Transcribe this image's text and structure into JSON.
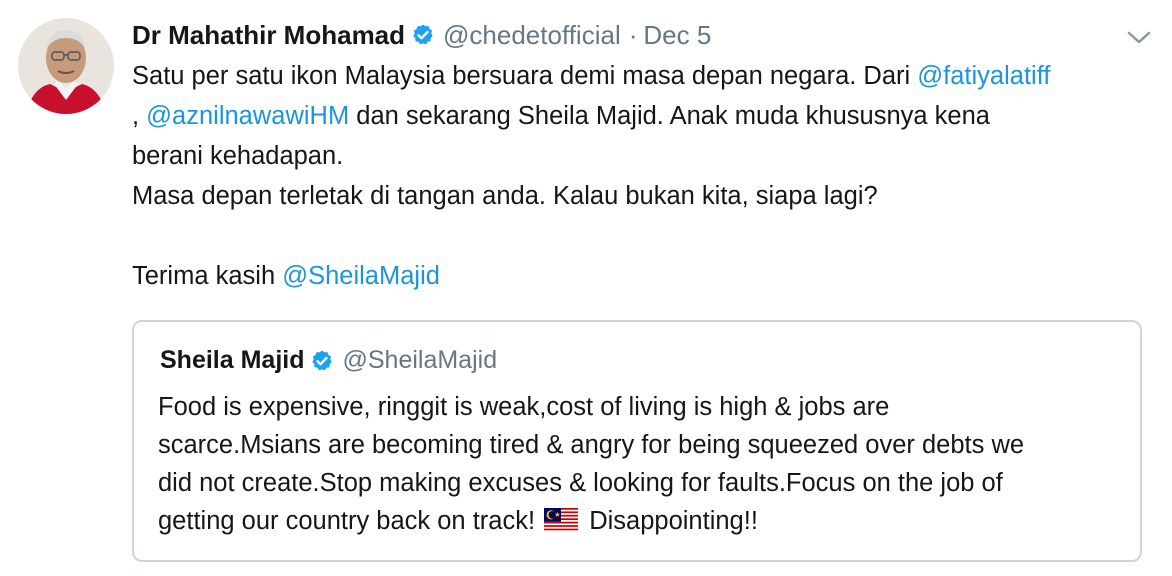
{
  "tweet": {
    "author_name": "Dr Mahathir Mohamad",
    "author_handle": "@chedetofficial",
    "separator": "·",
    "timestamp": "Dec 5",
    "body": {
      "line1_text": "Satu per satu ikon Malaysia bersuara demi masa depan negara. Dari ",
      "line1_mention": "@fatiyalatiff",
      "line2_prefix": ", ",
      "line2_mention": "@aznilnawawiHM",
      "line2_text": " dan sekarang Sheila Majid. Anak muda khususnya kena",
      "line3_text": "berani kehadapan.",
      "line4_text": "Masa depan terletak di tangan anda. Kalau bukan kita, siapa lagi?",
      "line5_text": "Terima kasih ",
      "line5_mention": "@SheilaMajid"
    }
  },
  "quoted_tweet": {
    "author_name": "Sheila Majid",
    "author_handle": "@SheilaMajid",
    "body": {
      "line1": "Food is expensive, ringgit is weak,cost of living is high & jobs are",
      "line2": "scarce.Msians are becoming tired & angry for being squeezed over debts we",
      "line3": "did not create.Stop making excuses & looking for faults.Focus on the job of",
      "line4_before_flag": "getting our country back on track! ",
      "line4_after_flag": " Disappointing!!"
    }
  },
  "colors": {
    "link": "#1b95e0",
    "secondary_text": "#657786",
    "verified": "#1da1f2",
    "border": "#ccd6dd"
  },
  "icons": {
    "verified": "verified-badge-icon",
    "menu": "chevron-down-icon",
    "flag": "malaysia-flag-emoji"
  }
}
